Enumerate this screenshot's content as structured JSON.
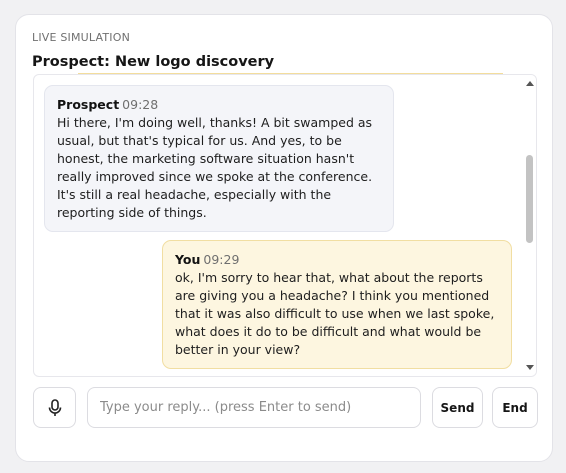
{
  "header": {
    "eyebrow": "LIVE SIMULATION",
    "title": "Prospect: New logo discovery"
  },
  "messages": [
    {
      "sender": "Prospect",
      "time": "09:28",
      "text": "Hi there, I'm doing well, thanks! A bit swamped as usual, but that's typical for us. And yes, to be honest, the marketing software situation hasn't really improved since we spoke at the conference. It's still a real headache, especially with the reporting side of things."
    },
    {
      "sender": "You",
      "time": "09:29",
      "text": "ok, I'm sorry to hear that, what about the reports are giving you a headache? I think you mentioned that it was also difficult to use when we last spoke, what does it do to be difficult and what would be better in your view?"
    }
  ],
  "composer": {
    "placeholder": "Type your reply... (press Enter to send)",
    "value": "",
    "send_label": "Send",
    "end_label": "End"
  },
  "icons": {
    "mic": "microphone-icon",
    "scroll_up": "chevron-up-icon",
    "scroll_down": "chevron-down-icon"
  },
  "colors": {
    "prospect_bubble": "#f4f5f9",
    "you_bubble": "#fdf6e0",
    "accent": "#f3dd9c"
  }
}
